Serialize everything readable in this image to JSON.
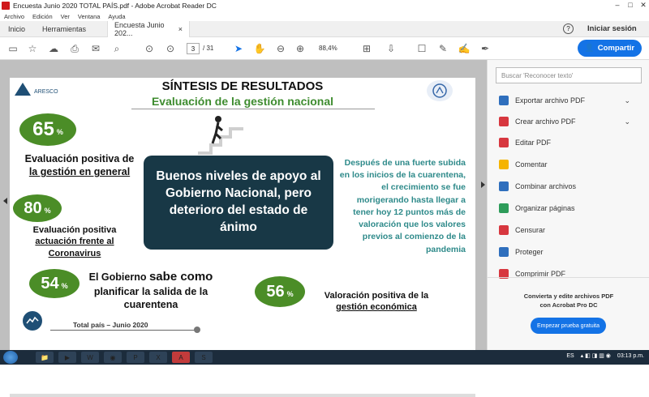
{
  "window": {
    "title": "Encuesta Junio 2020 TOTAL PAÍS.pdf - Adobe Acrobat Reader DC",
    "controls": [
      "–",
      "□",
      "✕"
    ]
  },
  "menu": [
    "Archivo",
    "Edición",
    "Ver",
    "Ventana",
    "Ayuda"
  ],
  "tabs": {
    "home": "Inicio",
    "tools": "Herramientas",
    "doc": "Encuesta Junio 202...",
    "doc_close": "×",
    "help": "?",
    "signin": "Iniciar sesión"
  },
  "toolbar": {
    "page_current": "3",
    "page_total": "/ 31",
    "zoom": "88,4%",
    "share_label": "Compartir"
  },
  "slide": {
    "title": "SÍNTESIS DE RESULTADOS",
    "subtitle": "Evaluación de la gestión nacional",
    "logo_left": "ARESCO",
    "pill1_value": "65",
    "pill1_pct": "%",
    "text1a": "Evaluación positiva de",
    "text1b": "la gestión en general",
    "pill2_value": "80",
    "pill2_pct": "%",
    "text2a": "Evaluación positiva",
    "text2b": "actuación frente al",
    "text2c": "Coronavirus",
    "pill3_value": "54",
    "pill3_pct": "%",
    "text3a": "El Gobierno",
    "text3b": "sabe como",
    "text3c": "planificar la salida de la",
    "text3d": "cuarentena",
    "pill4_value": "56",
    "pill4_pct": "%",
    "text4a": "Valoración positiva de la",
    "text4b": "gestión económica",
    "box": "Buenos niveles de apoyo al Gobierno Nacional, pero deterioro del estado de ánimo",
    "teal": "Después de una fuerte subida en los inicios de la cuarentena, el crecimiento se fue morigerando hasta llegar a tener hoy 12 puntos más de valoración que los valores previos al comienzo de la pandemia",
    "footer": "Total país – Junio 2020"
  },
  "rightpanel": {
    "search_placeholder": "Buscar 'Reconocer texto'",
    "items": [
      {
        "label": "Exportar archivo PDF",
        "icon": "export-pdf-icon",
        "color": "#2f6fbd",
        "chevron": true
      },
      {
        "label": "Crear archivo PDF",
        "icon": "create-pdf-icon",
        "color": "#d7373f",
        "chevron": true
      },
      {
        "label": "Editar PDF",
        "icon": "edit-pdf-icon",
        "color": "#d7373f",
        "chevron": false
      },
      {
        "label": "Comentar",
        "icon": "comment-icon",
        "color": "#f5b400",
        "chevron": false
      },
      {
        "label": "Combinar archivos",
        "icon": "combine-icon",
        "color": "#2f6fbd",
        "chevron": false
      },
      {
        "label": "Organizar páginas",
        "icon": "organize-icon",
        "color": "#2e9c5a",
        "chevron": false
      },
      {
        "label": "Censurar",
        "icon": "redact-icon",
        "color": "#d7373f",
        "chevron": false
      },
      {
        "label": "Proteger",
        "icon": "protect-icon",
        "color": "#2f6fbd",
        "chevron": false
      },
      {
        "label": "Comprimir PDF",
        "icon": "compress-icon",
        "color": "#d7373f",
        "chevron": false
      }
    ],
    "promo_line1": "Convierta y edite archivos PDF",
    "promo_line2": "con Acrobat Pro DC",
    "trial_label": "Empezar prueba gratuita"
  },
  "taskbar": {
    "lang": "ES",
    "time": "03:13 p.m."
  }
}
